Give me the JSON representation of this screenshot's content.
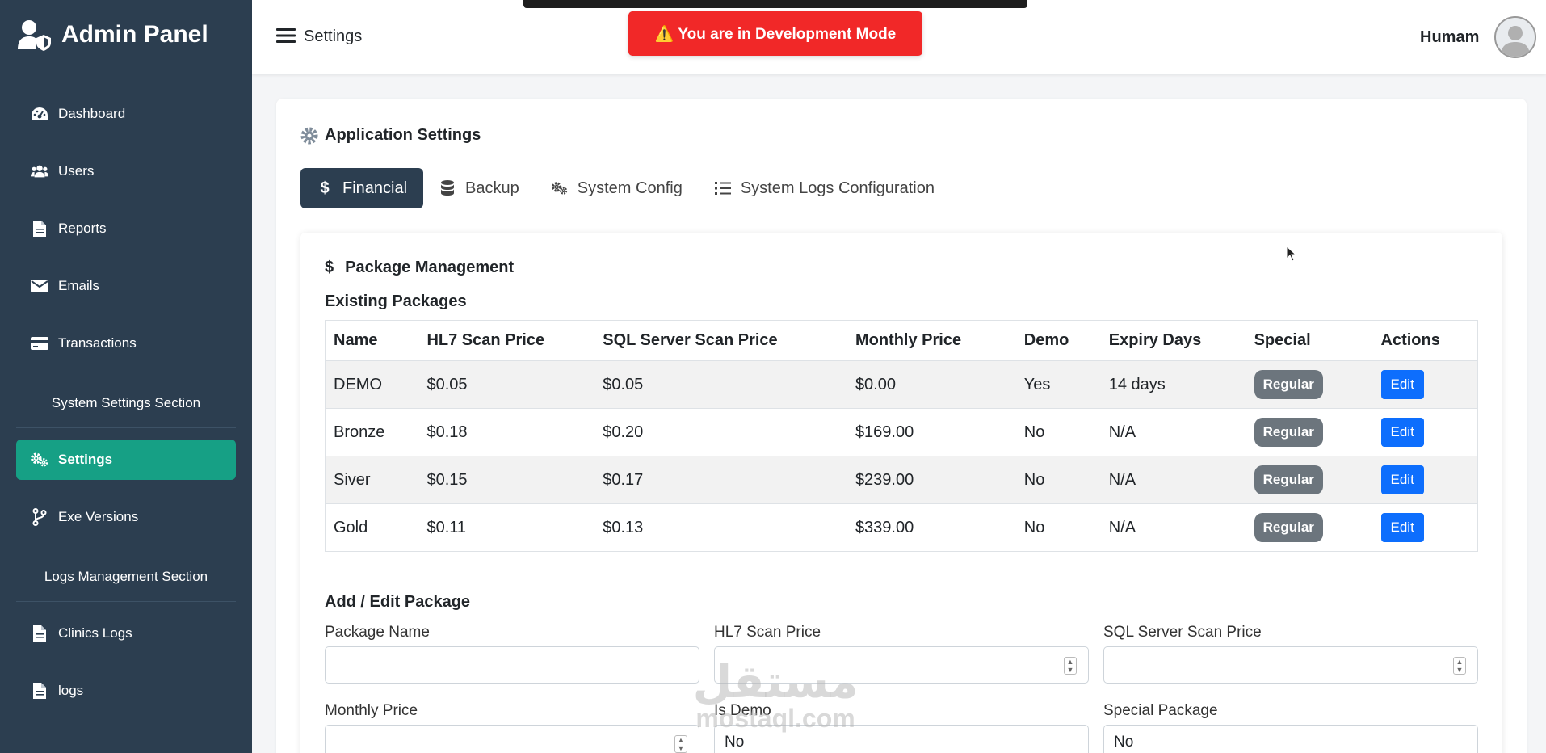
{
  "brand": {
    "title": "Admin Panel"
  },
  "sidebar": {
    "items": [
      {
        "label": "Dashboard",
        "icon": "dashboard-icon"
      },
      {
        "label": "Users",
        "icon": "users-icon"
      },
      {
        "label": "Reports",
        "icon": "file-icon"
      },
      {
        "label": "Emails",
        "icon": "envelope-icon"
      },
      {
        "label": "Transactions",
        "icon": "credit-card-icon"
      }
    ],
    "section_system": "System Settings Section",
    "settings_label": "Settings",
    "exe_label": "Exe Versions",
    "section_logs": "Logs Management Section",
    "clinics_logs_label": "Clinics Logs",
    "logs_label": "logs"
  },
  "header": {
    "page_title": "Settings",
    "dev_mode": "⚠️ You are in Development Mode",
    "user_name": "Humam"
  },
  "settings": {
    "title": "Application Settings",
    "tabs": [
      {
        "label": "Financial",
        "icon": "dollar-icon"
      },
      {
        "label": "Backup",
        "icon": "database-icon"
      },
      {
        "label": "System Config",
        "icon": "gears-icon"
      },
      {
        "label": "System Logs Configuration",
        "icon": "list-icon"
      }
    ]
  },
  "packages": {
    "title": "Package Management",
    "existing_title": "Existing Packages",
    "columns": [
      "Name",
      "HL7 Scan Price",
      "SQL Server Scan Price",
      "Monthly Price",
      "Demo",
      "Expiry Days",
      "Special",
      "Actions"
    ],
    "rows": [
      [
        "DEMO",
        "$0.05",
        "$0.05",
        "$0.00",
        "Yes",
        "14 days",
        "Regular",
        "Edit"
      ],
      [
        "Bronze",
        "$0.18",
        "$0.20",
        "$169.00",
        "No",
        "N/A",
        "Regular",
        "Edit"
      ],
      [
        "Siver",
        "$0.15",
        "$0.17",
        "$239.00",
        "No",
        "N/A",
        "Regular",
        "Edit"
      ],
      [
        "Gold",
        "$0.11",
        "$0.13",
        "$339.00",
        "No",
        "N/A",
        "Regular",
        "Edit"
      ]
    ]
  },
  "form": {
    "title": "Add / Edit Package",
    "package_name_label": "Package Name",
    "package_name_value": "",
    "hl7_label": "HL7 Scan Price",
    "hl7_value": "",
    "sql_label": "SQL Server Scan Price",
    "sql_value": "",
    "monthly_label": "Monthly Price",
    "monthly_value": "",
    "demo_label": "Is Demo",
    "demo_value": "No",
    "special_label": "Special Package",
    "special_value": "No"
  },
  "watermark": {
    "arabic": "مستقل",
    "latin": "mostaql.com"
  },
  "colors": {
    "sidebar": "#2c3e50",
    "accent": "#16a085",
    "danger": "#f12828",
    "primary": "#0d6efd",
    "badge": "#6c757d"
  }
}
